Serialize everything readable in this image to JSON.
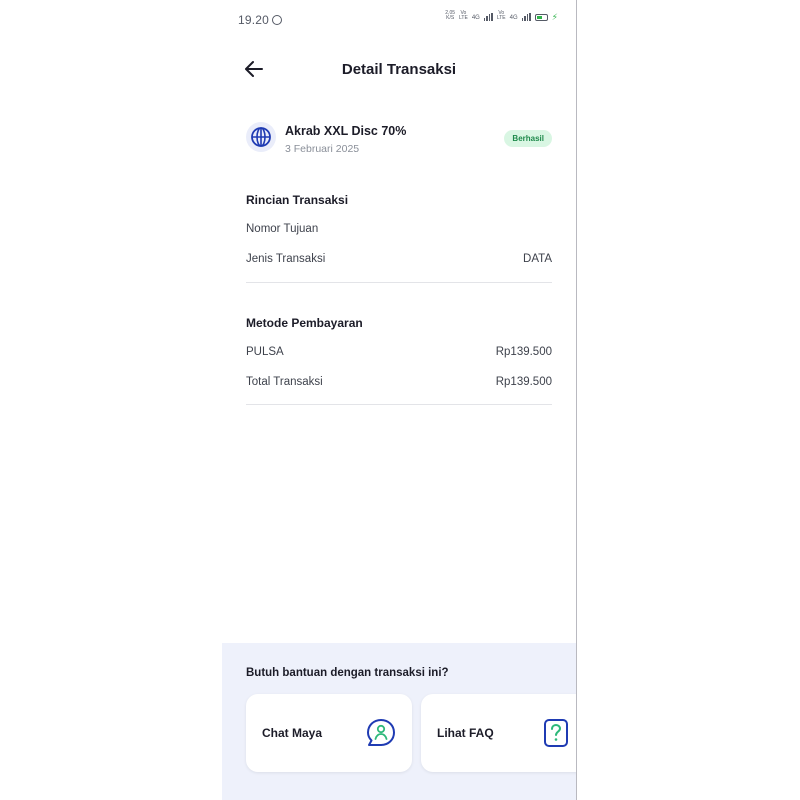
{
  "status_bar": {
    "time": "19.20",
    "net_speed": "2,05",
    "net_unit": "K/S",
    "sim1_tag_top": "Vo",
    "sim1_tag_bottom": "LTE",
    "sim1_network": "4G",
    "sim2_tag_top": "Vo",
    "sim2_tag_bottom": "LTE",
    "sim2_network": "4G",
    "battery_fraction": 0.55,
    "battery_color": "#2fb24a"
  },
  "header": {
    "back_icon": "arrow-left-icon",
    "title": "Detail Transaksi"
  },
  "product": {
    "icon": "globe-icon",
    "name": "Akrab XXL Disc 70%",
    "date": "3 Februari 2025",
    "status": "Berhasil",
    "status_color": "#1f8a4c",
    "status_bg": "#d9f6e3"
  },
  "details": {
    "title": "Rincian Transaksi",
    "rows": [
      {
        "label": "Nomor Tujuan",
        "value": ""
      },
      {
        "label": "Jenis Transaksi",
        "value": "DATA"
      }
    ]
  },
  "payment": {
    "title": "Metode Pembayaran",
    "rows": [
      {
        "label": "PULSA",
        "value": "Rp139.500"
      },
      {
        "label": "Total Transaksi",
        "value": "Rp139.500"
      }
    ]
  },
  "help": {
    "title": "Butuh bantuan dengan transaksi ini?",
    "cards": [
      {
        "label": "Chat Maya",
        "icon": "chat-support-icon"
      },
      {
        "label": "Lihat FAQ",
        "icon": "faq-question-icon"
      }
    ],
    "accent": "#1f3bb3"
  }
}
